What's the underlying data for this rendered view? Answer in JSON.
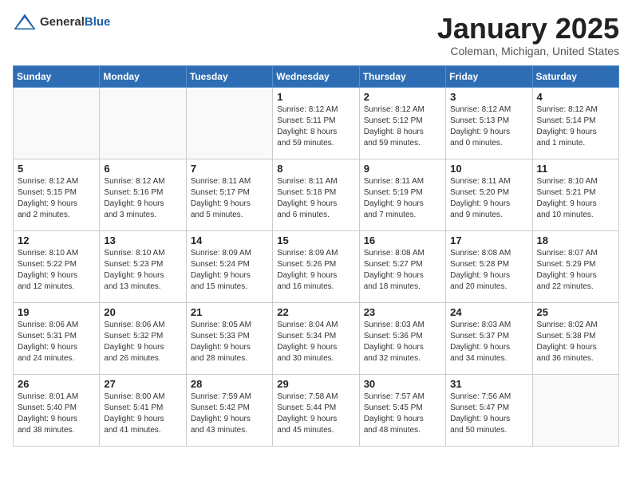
{
  "header": {
    "logo_general": "General",
    "logo_blue": "Blue",
    "month": "January 2025",
    "location": "Coleman, Michigan, United States"
  },
  "weekdays": [
    "Sunday",
    "Monday",
    "Tuesday",
    "Wednesday",
    "Thursday",
    "Friday",
    "Saturday"
  ],
  "weeks": [
    [
      {
        "day": "",
        "info": ""
      },
      {
        "day": "",
        "info": ""
      },
      {
        "day": "",
        "info": ""
      },
      {
        "day": "1",
        "info": "Sunrise: 8:12 AM\nSunset: 5:11 PM\nDaylight: 8 hours\nand 59 minutes."
      },
      {
        "day": "2",
        "info": "Sunrise: 8:12 AM\nSunset: 5:12 PM\nDaylight: 8 hours\nand 59 minutes."
      },
      {
        "day": "3",
        "info": "Sunrise: 8:12 AM\nSunset: 5:13 PM\nDaylight: 9 hours\nand 0 minutes."
      },
      {
        "day": "4",
        "info": "Sunrise: 8:12 AM\nSunset: 5:14 PM\nDaylight: 9 hours\nand 1 minute."
      }
    ],
    [
      {
        "day": "5",
        "info": "Sunrise: 8:12 AM\nSunset: 5:15 PM\nDaylight: 9 hours\nand 2 minutes."
      },
      {
        "day": "6",
        "info": "Sunrise: 8:12 AM\nSunset: 5:16 PM\nDaylight: 9 hours\nand 3 minutes."
      },
      {
        "day": "7",
        "info": "Sunrise: 8:11 AM\nSunset: 5:17 PM\nDaylight: 9 hours\nand 5 minutes."
      },
      {
        "day": "8",
        "info": "Sunrise: 8:11 AM\nSunset: 5:18 PM\nDaylight: 9 hours\nand 6 minutes."
      },
      {
        "day": "9",
        "info": "Sunrise: 8:11 AM\nSunset: 5:19 PM\nDaylight: 9 hours\nand 7 minutes."
      },
      {
        "day": "10",
        "info": "Sunrise: 8:11 AM\nSunset: 5:20 PM\nDaylight: 9 hours\nand 9 minutes."
      },
      {
        "day": "11",
        "info": "Sunrise: 8:10 AM\nSunset: 5:21 PM\nDaylight: 9 hours\nand 10 minutes."
      }
    ],
    [
      {
        "day": "12",
        "info": "Sunrise: 8:10 AM\nSunset: 5:22 PM\nDaylight: 9 hours\nand 12 minutes."
      },
      {
        "day": "13",
        "info": "Sunrise: 8:10 AM\nSunset: 5:23 PM\nDaylight: 9 hours\nand 13 minutes."
      },
      {
        "day": "14",
        "info": "Sunrise: 8:09 AM\nSunset: 5:24 PM\nDaylight: 9 hours\nand 15 minutes."
      },
      {
        "day": "15",
        "info": "Sunrise: 8:09 AM\nSunset: 5:26 PM\nDaylight: 9 hours\nand 16 minutes."
      },
      {
        "day": "16",
        "info": "Sunrise: 8:08 AM\nSunset: 5:27 PM\nDaylight: 9 hours\nand 18 minutes."
      },
      {
        "day": "17",
        "info": "Sunrise: 8:08 AM\nSunset: 5:28 PM\nDaylight: 9 hours\nand 20 minutes."
      },
      {
        "day": "18",
        "info": "Sunrise: 8:07 AM\nSunset: 5:29 PM\nDaylight: 9 hours\nand 22 minutes."
      }
    ],
    [
      {
        "day": "19",
        "info": "Sunrise: 8:06 AM\nSunset: 5:31 PM\nDaylight: 9 hours\nand 24 minutes."
      },
      {
        "day": "20",
        "info": "Sunrise: 8:06 AM\nSunset: 5:32 PM\nDaylight: 9 hours\nand 26 minutes."
      },
      {
        "day": "21",
        "info": "Sunrise: 8:05 AM\nSunset: 5:33 PM\nDaylight: 9 hours\nand 28 minutes."
      },
      {
        "day": "22",
        "info": "Sunrise: 8:04 AM\nSunset: 5:34 PM\nDaylight: 9 hours\nand 30 minutes."
      },
      {
        "day": "23",
        "info": "Sunrise: 8:03 AM\nSunset: 5:36 PM\nDaylight: 9 hours\nand 32 minutes."
      },
      {
        "day": "24",
        "info": "Sunrise: 8:03 AM\nSunset: 5:37 PM\nDaylight: 9 hours\nand 34 minutes."
      },
      {
        "day": "25",
        "info": "Sunrise: 8:02 AM\nSunset: 5:38 PM\nDaylight: 9 hours\nand 36 minutes."
      }
    ],
    [
      {
        "day": "26",
        "info": "Sunrise: 8:01 AM\nSunset: 5:40 PM\nDaylight: 9 hours\nand 38 minutes."
      },
      {
        "day": "27",
        "info": "Sunrise: 8:00 AM\nSunset: 5:41 PM\nDaylight: 9 hours\nand 41 minutes."
      },
      {
        "day": "28",
        "info": "Sunrise: 7:59 AM\nSunset: 5:42 PM\nDaylight: 9 hours\nand 43 minutes."
      },
      {
        "day": "29",
        "info": "Sunrise: 7:58 AM\nSunset: 5:44 PM\nDaylight: 9 hours\nand 45 minutes."
      },
      {
        "day": "30",
        "info": "Sunrise: 7:57 AM\nSunset: 5:45 PM\nDaylight: 9 hours\nand 48 minutes."
      },
      {
        "day": "31",
        "info": "Sunrise: 7:56 AM\nSunset: 5:47 PM\nDaylight: 9 hours\nand 50 minutes."
      },
      {
        "day": "",
        "info": ""
      }
    ]
  ]
}
